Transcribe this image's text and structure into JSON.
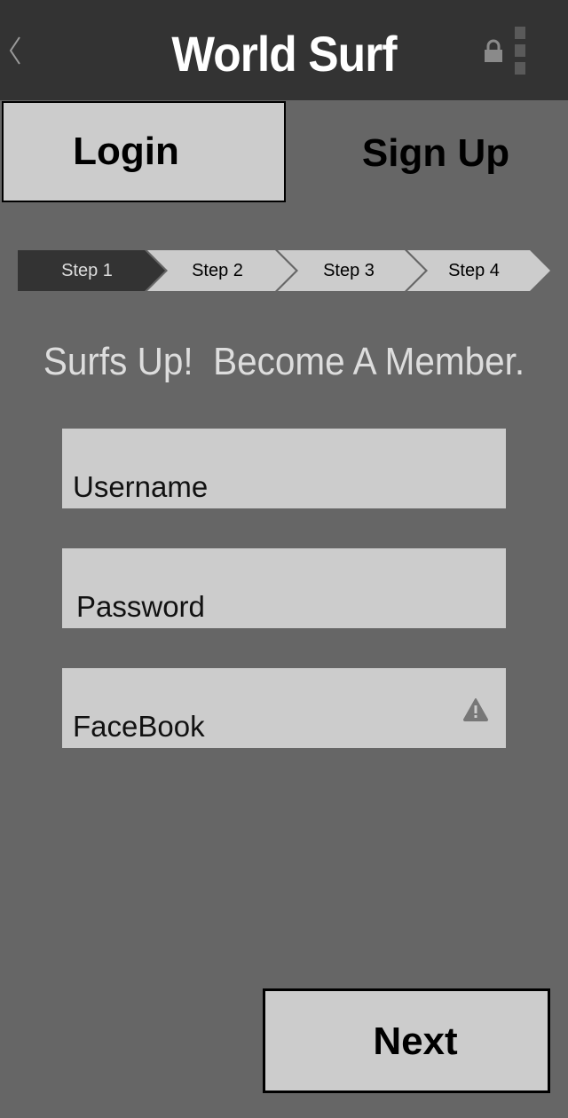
{
  "appbar": {
    "title": "World Surf"
  },
  "tabs": {
    "login_label": "Login",
    "signup_label": "Sign Up"
  },
  "steps": [
    {
      "label": "Step 1",
      "active": true
    },
    {
      "label": "Step 2",
      "active": false
    },
    {
      "label": "Step 3",
      "active": false
    },
    {
      "label": "Step 4",
      "active": false
    }
  ],
  "headline": "Surfs Up!  Become A Member.",
  "form": {
    "username_label": "Username",
    "password_label": "Password",
    "facebook_label": "FaceBook"
  },
  "footer": {
    "next_label": "Next"
  },
  "colors": {
    "background": "#666666",
    "appbar": "#333333",
    "light_gray": "#cccccc",
    "step_active": "#333333"
  },
  "icons": {
    "back": "chevron-left-icon",
    "lock": "lock-icon",
    "more": "more-vertical-icon",
    "warning": "warning-icon"
  }
}
